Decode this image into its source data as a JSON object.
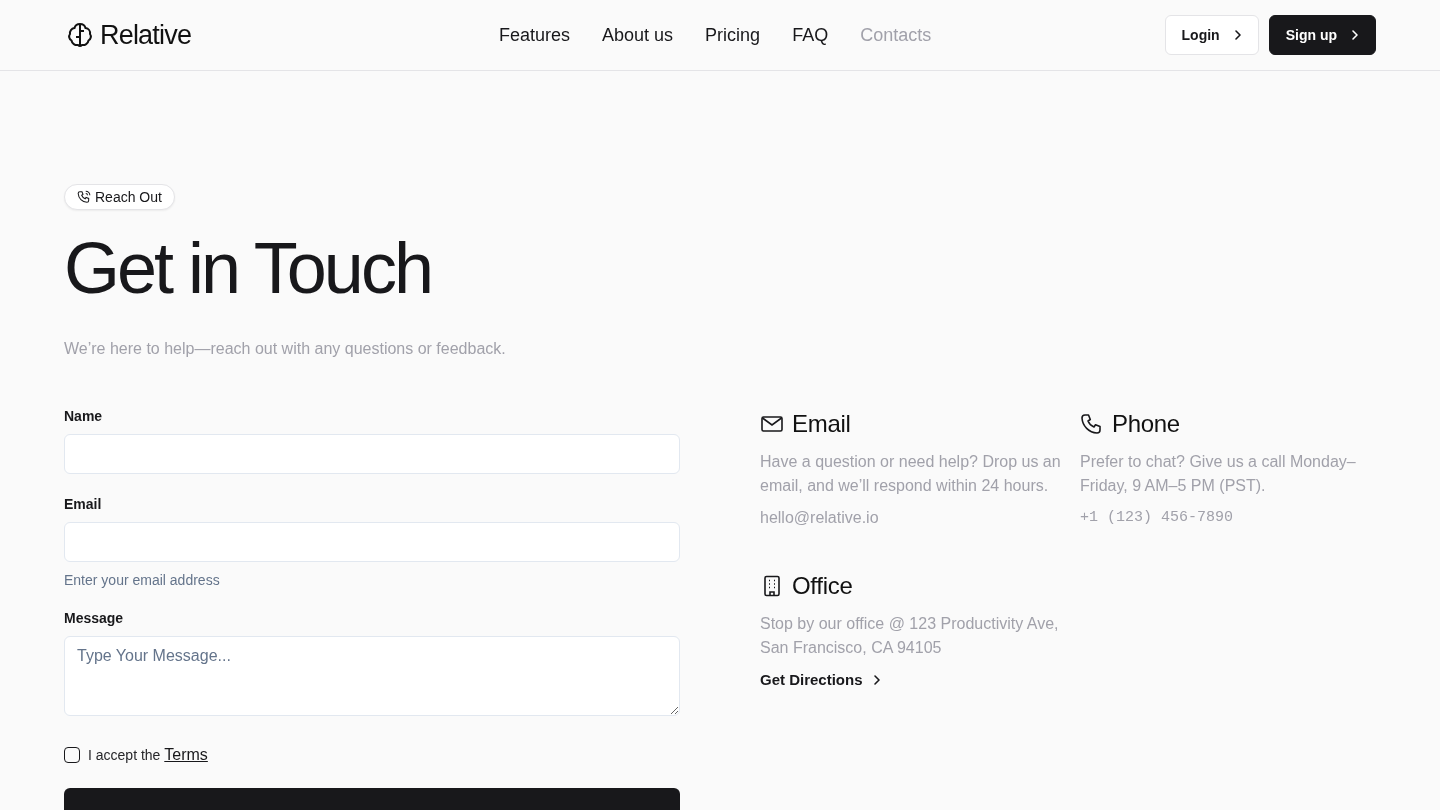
{
  "header": {
    "logo": "Relative",
    "nav": [
      {
        "label": "Features",
        "selected": false
      },
      {
        "label": "About us",
        "selected": false
      },
      {
        "label": "Pricing",
        "selected": false
      },
      {
        "label": "FAQ",
        "selected": false
      },
      {
        "label": "Contacts",
        "selected": true
      }
    ],
    "buttons": [
      {
        "label": "Login",
        "kind": "outline"
      },
      {
        "label": "Sign up",
        "kind": "solid"
      }
    ]
  },
  "hero": {
    "badge": "Reach Out",
    "title": "Get in Touch",
    "subtitle": "We’re here to help—reach out with any questions or feedback."
  },
  "form": {
    "fields": [
      {
        "label": "Name",
        "kind": "input"
      },
      {
        "label": "Email",
        "kind": "input",
        "hint": "Enter your email address"
      },
      {
        "label": "Message",
        "kind": "textarea",
        "placeholder": "Type Your Message..."
      }
    ],
    "checkbox": {
      "text": "I accept the",
      "link": "Terms",
      "checked": false
    }
  },
  "contacts": [
    {
      "kind": "email",
      "title": "Email",
      "text": "Have a question or need help? Drop us an email, and we’ll respond within 24 hours.",
      "detail": "hello@relative.io"
    },
    {
      "kind": "phone",
      "title": "Phone",
      "text": "Prefer to chat? Give us a call Monday–Friday, 9 AM–5 PM (PST).",
      "detail": "+1 (123) 456-7890"
    },
    {
      "kind": "office",
      "title": "Office",
      "text": "Stop by our office @ 123 Productivity Ave, San Francisco, CA 94105",
      "link": "Get Directions"
    }
  ]
}
